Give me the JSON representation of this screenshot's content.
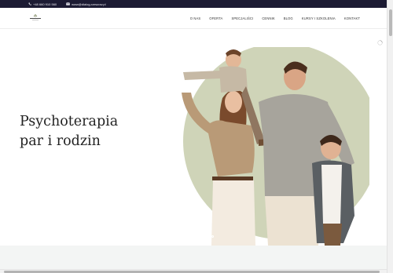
{
  "topbar": {
    "phone": "+48 660 910 560",
    "email": "www@dialog-rzeszow.pl",
    "icons": [
      "phone-icon",
      "mail-icon"
    ]
  },
  "nav": {
    "items": [
      {
        "label": "O NAS"
      },
      {
        "label": "OFERTA"
      },
      {
        "label": "SPECJALIŚCI"
      },
      {
        "label": "CENNIK"
      },
      {
        "label": "BLOG"
      },
      {
        "label": "KURSY I SZKOLENIA"
      },
      {
        "label": "KONTAKT"
      }
    ]
  },
  "hero": {
    "title_line1": "Psychoterapia",
    "title_line2": "par i rodzin",
    "slides": 3,
    "active_slide": 1
  },
  "colors": {
    "topbar": "#1c1b33",
    "circle": "#cfd4b8",
    "section_bg": "#f3f5f4"
  }
}
